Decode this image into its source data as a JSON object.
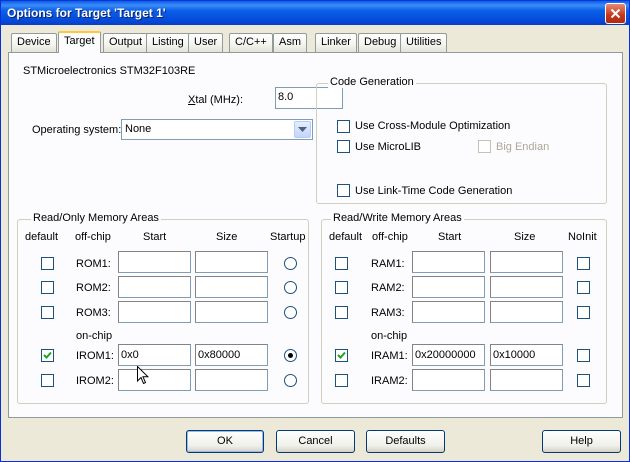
{
  "window": {
    "title": "Options for Target 'Target 1'"
  },
  "tabs": [
    {
      "label": "Device"
    },
    {
      "label": "Target"
    },
    {
      "label": "Output"
    },
    {
      "label": "Listing"
    },
    {
      "label": "User"
    },
    {
      "label": "C/C++"
    },
    {
      "label": "Asm"
    },
    {
      "label": "Linker"
    },
    {
      "label": "Debug"
    },
    {
      "label": "Utilities"
    }
  ],
  "active_tab": "Target",
  "device": {
    "name": "STMicroelectronics STM32F103RE"
  },
  "xtal": {
    "label_prefix": "X",
    "label_rest": "tal (MHz):",
    "value": "8.0"
  },
  "os": {
    "label": "Operating system:",
    "value": "None"
  },
  "codegen": {
    "title": "Code Generation",
    "cross_module": {
      "label": "Use Cross-Module Optimization",
      "checked": false
    },
    "microlib": {
      "label": "Use MicroLIB",
      "checked": false
    },
    "big_endian": {
      "label": "Big Endian",
      "checked": false,
      "disabled": true
    },
    "link_time": {
      "label": "Use Link-Time Code Generation",
      "checked": false
    }
  },
  "rom": {
    "title": "Read/Only Memory Areas",
    "headers": {
      "default": "default",
      "offchip": "off-chip",
      "start": "Start",
      "size": "Size",
      "last": "Startup"
    },
    "onchip_label": "on-chip",
    "rows": [
      {
        "name": "ROM1:",
        "start": "",
        "size": "",
        "default": false,
        "startup": false
      },
      {
        "name": "ROM2:",
        "start": "",
        "size": "",
        "default": false,
        "startup": false
      },
      {
        "name": "ROM3:",
        "start": "",
        "size": "",
        "default": false,
        "startup": false
      },
      {
        "name": "IROM1:",
        "start": "0x0",
        "size": "0x80000",
        "default": true,
        "startup": true
      },
      {
        "name": "IROM2:",
        "start": "",
        "size": "",
        "default": false,
        "startup": false
      }
    ]
  },
  "ram": {
    "title": "Read/Write Memory Areas",
    "headers": {
      "default": "default",
      "offchip": "off-chip",
      "start": "Start",
      "size": "Size",
      "last": "NoInit"
    },
    "onchip_label": "on-chip",
    "rows": [
      {
        "name": "RAM1:",
        "start": "",
        "size": "",
        "default": false,
        "noinit": false
      },
      {
        "name": "RAM2:",
        "start": "",
        "size": "",
        "default": false,
        "noinit": false
      },
      {
        "name": "RAM3:",
        "start": "",
        "size": "",
        "default": false,
        "noinit": false
      },
      {
        "name": "IRAM1:",
        "start": "0x20000000",
        "size": "0x10000",
        "default": true,
        "noinit": false
      },
      {
        "name": "IRAM2:",
        "start": "",
        "size": "",
        "default": false,
        "noinit": false
      }
    ]
  },
  "buttons": {
    "ok": "OK",
    "cancel": "Cancel",
    "defaults": "Defaults",
    "help": "Help"
  },
  "colors": {
    "title_bar": "#0A5FE8",
    "dialog_bg": "#ECE9D8",
    "tab_accent": "#FFC83C"
  }
}
